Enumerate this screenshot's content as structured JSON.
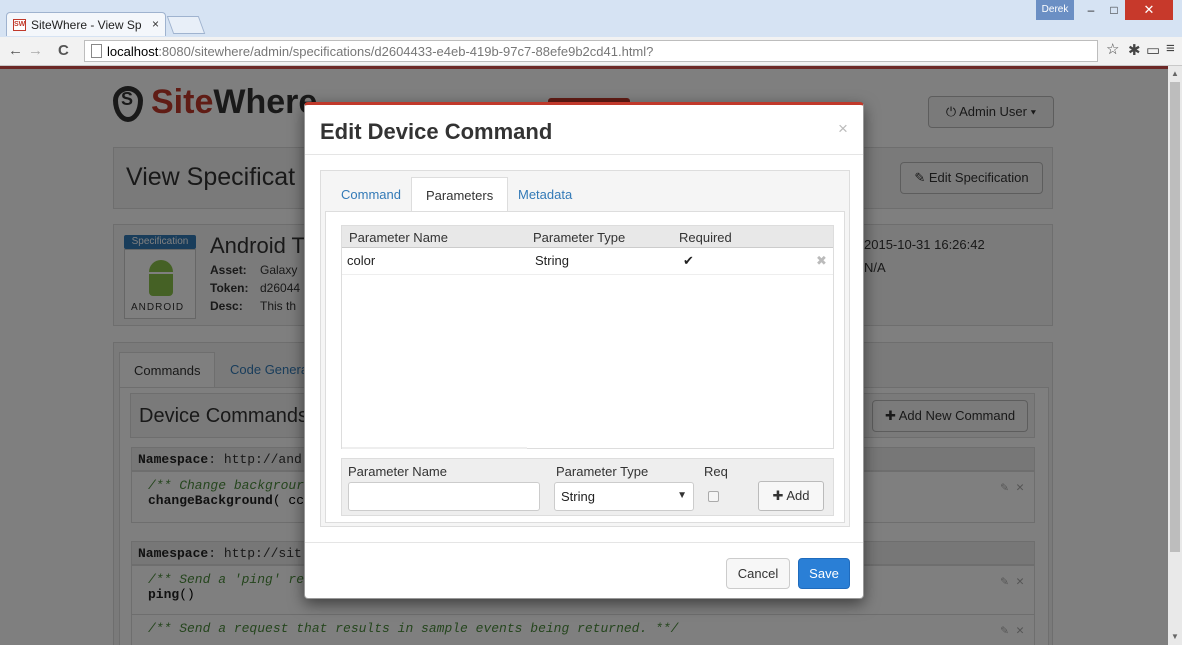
{
  "browser": {
    "tab_title": "SiteWhere - View Sp",
    "tab_favicon_text": "SW",
    "tab_close": "×",
    "window_user": "Derek",
    "minimize": "–",
    "maximize": "□",
    "close": "✕",
    "back": "←",
    "forward": "→",
    "reload": "C",
    "url_host": "localhost",
    "url_rest": ":8080/sitewhere/admin/specifications/d2604433-e4eb-419b-97c7-88efe9b2cd41.html?",
    "star": "☆",
    "settings": "✱",
    "cast": "▭",
    "menu": "≡"
  },
  "page": {
    "logo_text_1": "Site",
    "logo_text_2": "Where",
    "admin_button": "⏻ Admin User ▾",
    "view_title": "View Specificat",
    "edit_spec_button": "✎ Edit Specification",
    "spec_badge": "Specification",
    "android_label": "ANDROID",
    "spec_name": "Android T",
    "asset_label": "Asset:",
    "asset_value": "Galaxy",
    "token_label": "Token:",
    "token_value": "d26044",
    "desc_label": "Desc:",
    "desc_value": "This th",
    "created": "2015-10-31 16:26:42",
    "updated": "N/A",
    "tab_commands": "Commands",
    "tab_code": "Code Genera",
    "device_commands_title": "Device Commands",
    "add_command_button": "✚ Add New Command",
    "ns1_label": "Namespace",
    "ns1_value": ": http://and",
    "cmd1_comment": "/** Change backgrour",
    "cmd1_name": "changeBackground",
    "cmd1_args": "( cc",
    "ns2_label": "Namespace",
    "ns2_value": ": http://sit",
    "cmd2_comment": "/** Send a 'ping' re",
    "cmd2_name": "ping",
    "cmd2_args": "()",
    "cmd3_comment": "/** Send a request that results in sample events being returned. **/",
    "row_actions": "✎ ✕"
  },
  "modal": {
    "title": "Edit Device Command",
    "close": "×",
    "tabs": [
      {
        "label": "Command"
      },
      {
        "label": "Parameters"
      },
      {
        "label": "Metadata"
      }
    ],
    "grid": {
      "columns": [
        "Parameter Name",
        "Parameter Type",
        "Required"
      ],
      "rows": [
        {
          "name": "color",
          "type": "String",
          "required": "✔",
          "delete": "✖"
        }
      ]
    },
    "form": {
      "name_label": "Parameter Name",
      "name_value": "",
      "type_label": "Parameter Type",
      "type_value": "String",
      "type_arrow": "▼",
      "req_label": "Req",
      "add_button": "✚ Add"
    },
    "cancel_button": "Cancel",
    "save_button": "Save"
  },
  "colors": {
    "accent_red": "#c0392b",
    "primary_blue": "#2a7fd6",
    "link_blue": "#337ab7"
  }
}
